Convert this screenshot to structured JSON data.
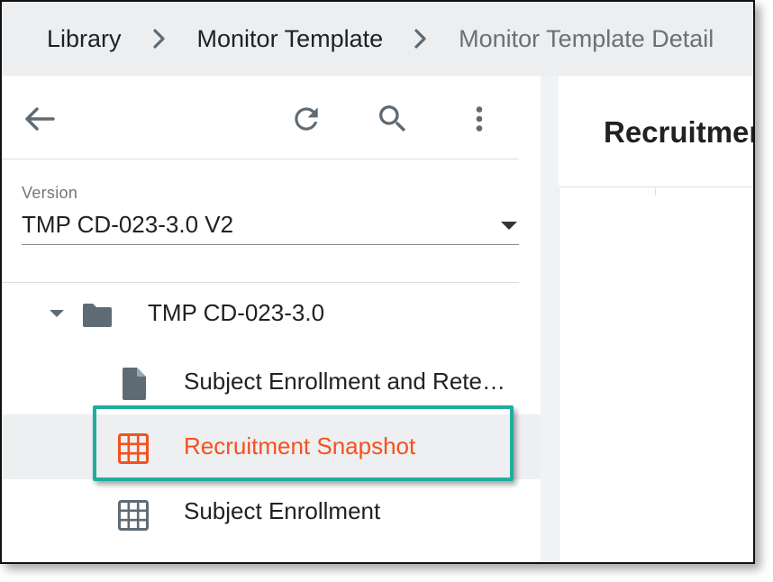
{
  "breadcrumb": {
    "items": [
      {
        "label": "Library"
      },
      {
        "label": "Monitor Template"
      },
      {
        "label": "Monitor Template Detail"
      }
    ]
  },
  "toolbar": {
    "back_icon": "arrow-left-icon",
    "refresh_icon": "refresh-icon",
    "search_icon": "search-icon",
    "more_icon": "more-vert-icon"
  },
  "version": {
    "label": "Version",
    "value": "TMP CD-023-3.0 V2"
  },
  "tree": {
    "folder": {
      "label": "TMP CD-023-3.0",
      "icon": "folder-icon",
      "expanded": true
    },
    "items": [
      {
        "label": "Subject Enrollment and Rete…",
        "icon": "document-icon",
        "selected": false
      },
      {
        "label": "Recruitment Snapshot",
        "icon": "grid-icon",
        "selected": true
      },
      {
        "label": "Subject Enrollment",
        "icon": "grid-icon",
        "selected": false
      }
    ]
  },
  "detail": {
    "title": "Recruitmen"
  },
  "colors": {
    "accent": "#f4511e",
    "highlight_border": "#1fae9e",
    "icon_gray": "#5f6b74",
    "breadcrumb_bg": "#eceef0",
    "selected_row_bg": "#eeeff1"
  }
}
